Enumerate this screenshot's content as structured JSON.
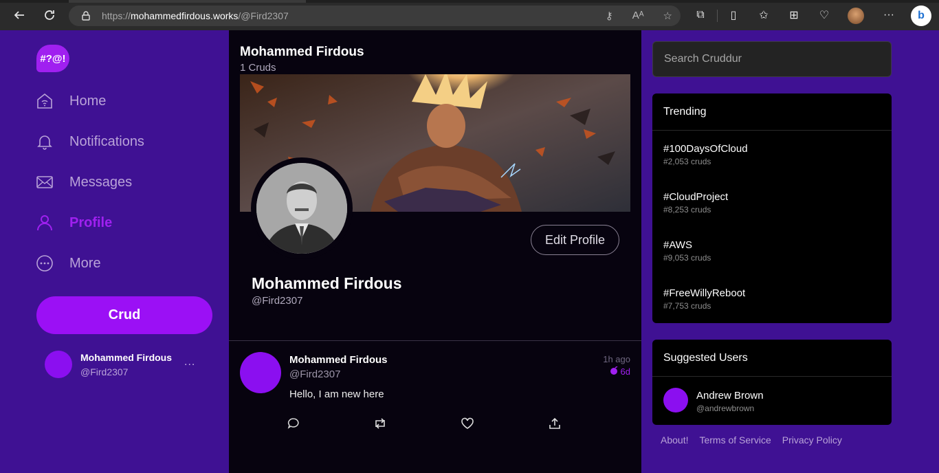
{
  "browser": {
    "url_scheme": "https://",
    "url_host": "mohammedfirdous.works",
    "url_path": "/@Fird2307"
  },
  "app": {
    "logo_text": "#?@!",
    "brand_color": "#9b10f5",
    "background_color": "#3f1193"
  },
  "sidebar": {
    "items": [
      {
        "label": "Home",
        "icon": "home-icon"
      },
      {
        "label": "Notifications",
        "icon": "bell-icon"
      },
      {
        "label": "Messages",
        "icon": "mail-icon"
      },
      {
        "label": "Profile",
        "icon": "person-icon",
        "active": true
      },
      {
        "label": "More",
        "icon": "more-circle-icon"
      }
    ],
    "crud_button": "Crud",
    "current_user": {
      "name": "Mohammed Firdous",
      "handle": "@Fird2307",
      "more": "..."
    }
  },
  "profile": {
    "header_name": "Mohammed Firdous",
    "header_count": "1 Cruds",
    "display_name": "Mohammed Firdous",
    "handle": "@Fird2307",
    "edit_button": "Edit Profile"
  },
  "posts": [
    {
      "name": "Mohammed Firdous",
      "handle": "@Fird2307",
      "time": "1h ago",
      "expires": "6d",
      "body": "Hello, I am new here"
    }
  ],
  "search": {
    "placeholder": "Search Cruddur"
  },
  "trending": {
    "title": "Trending",
    "items": [
      {
        "tag": "#100DaysOfCloud",
        "count": "#2,053 cruds"
      },
      {
        "tag": "#CloudProject",
        "count": "#8,253 cruds"
      },
      {
        "tag": "#AWS",
        "count": "#9,053 cruds"
      },
      {
        "tag": "#FreeWillyReboot",
        "count": "#7,753 cruds"
      }
    ]
  },
  "suggested": {
    "title": "Suggested Users",
    "users": [
      {
        "name": "Andrew Brown",
        "handle": "@andrewbrown"
      }
    ]
  },
  "footer": {
    "about": "About!",
    "terms": "Terms of Service",
    "privacy": "Privacy Policy"
  }
}
